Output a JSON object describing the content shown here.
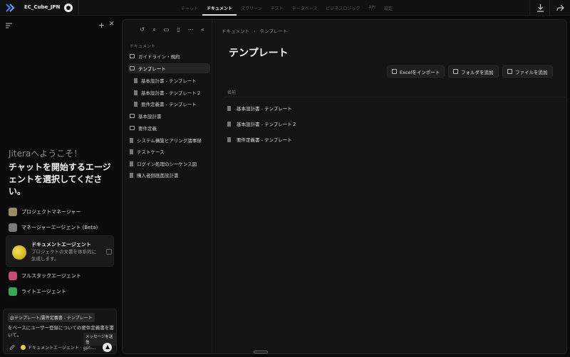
{
  "topbar": {
    "project_name": "EC_Cube_JPN",
    "nav": [
      "チャット",
      "ドキュメント",
      "スクリーン",
      "テスト",
      "データベース",
      "ビジネスロジック",
      "API",
      "設定"
    ],
    "active_nav": "ドキュメント"
  },
  "chat": {
    "welcome_line1": "Jiteraへようこそ！",
    "welcome_line2": "チャットを開始するエージェントを選択してください。",
    "agents": [
      {
        "name": "プロジェクトマネージャー",
        "color": "#9a8c6a"
      },
      {
        "name": "マネージャーエージェント (Beta)",
        "color": "#7a7a7a"
      }
    ],
    "active_agent": {
      "name": "ドキュメントエージェント",
      "description": "プロジェクトの文書を体系的に生成します。"
    },
    "agents_after": [
      {
        "name": "フルスタックエージェント",
        "color": "#c94a7a"
      },
      {
        "name": "ライトエージェント",
        "color": "#3aa55a"
      }
    ],
    "composer": {
      "mention": "@テンプレート/要件定義書 - テンプレート",
      "text": "をベースにユーザー登録についての要件定義書を書いて。",
      "tooltip": "メッセージを送信",
      "agent_label": "ドキュメントエージェント · gpt-..."
    }
  },
  "tree": {
    "section": "ドキュメント",
    "items": [
      {
        "label": "ガイドライン・規約",
        "kind": "folder",
        "level": 0
      },
      {
        "label": "テンプレート",
        "kind": "folder-open",
        "level": 0,
        "active": true
      },
      {
        "label": "基本設計書 - テンプレート",
        "kind": "file",
        "level": 1
      },
      {
        "label": "基本設計書 - テンプレート２",
        "kind": "file",
        "level": 1
      },
      {
        "label": "要件定義書 - テンプレート",
        "kind": "file",
        "level": 1
      },
      {
        "label": "基本設計書",
        "kind": "folder",
        "level": 0
      },
      {
        "label": "要件定義",
        "kind": "folder",
        "level": 0
      },
      {
        "label": "システム構築ヒアリング議事録",
        "kind": "file",
        "level": 0
      },
      {
        "label": "テストケース",
        "kind": "file",
        "level": 0
      },
      {
        "label": "ログイン処理のシーケンス図",
        "kind": "file",
        "level": 0
      },
      {
        "label": "購入者側画面設計書",
        "kind": "file",
        "level": 0
      }
    ]
  },
  "content": {
    "breadcrumb_root": "ドキュメント",
    "breadcrumb_current": "テンプレート",
    "title": "テンプレート",
    "buttons": {
      "import_excel": "Excelをインポート",
      "add_folder": "フォルダを追加",
      "add_file": "ファイルを追加"
    },
    "column_name": "名前",
    "rows": [
      "基本設計書 - テンプレート",
      "基本設計書 - テンプレート２",
      "要件定義書 - テンプレート"
    ]
  }
}
